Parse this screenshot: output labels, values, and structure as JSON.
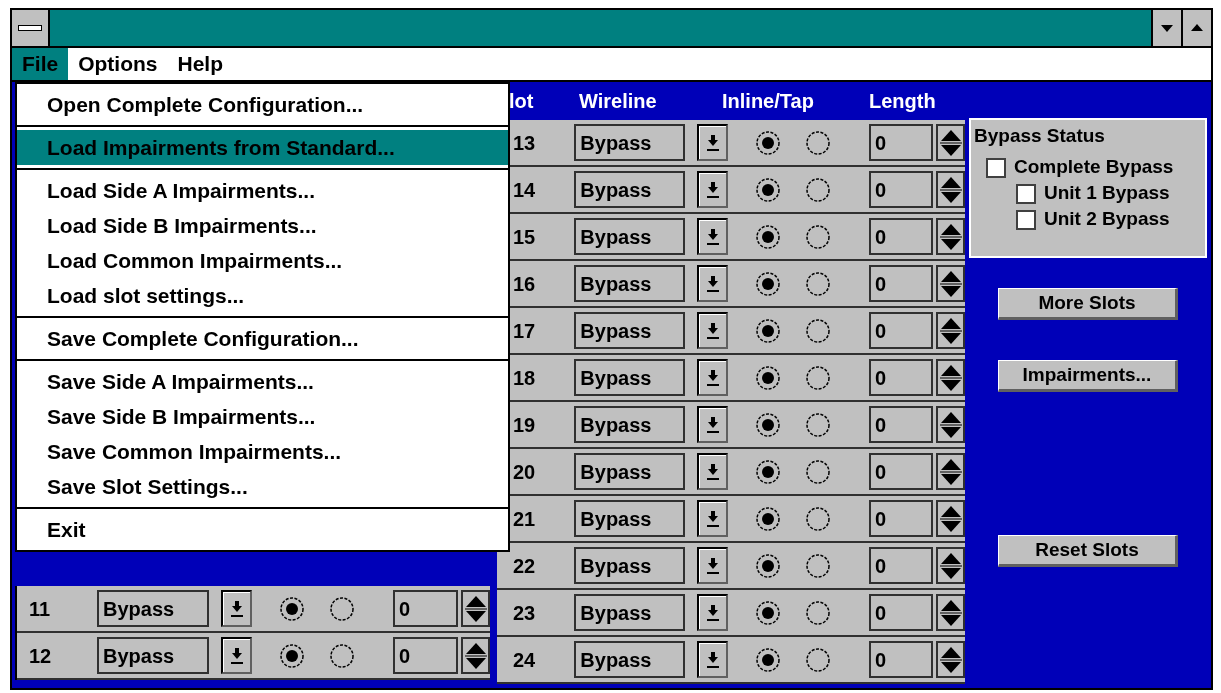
{
  "menubar": [
    {
      "label": "File",
      "selected": true
    },
    {
      "label": "Options",
      "selected": false
    },
    {
      "label": "Help",
      "selected": false
    }
  ],
  "file_menu": {
    "groups": [
      [
        {
          "label": "Open Complete Configuration...",
          "selected": false
        }
      ],
      [
        {
          "label": "Load Impairments from Standard...",
          "selected": true
        }
      ],
      [
        {
          "label": "Load Side A Impairments...",
          "selected": false
        },
        {
          "label": "Load Side B Impairments...",
          "selected": false
        },
        {
          "label": "Load Common Impairments...",
          "selected": false
        },
        {
          "label": "Load slot settings...",
          "selected": false
        }
      ],
      [
        {
          "label": "Save Complete Configuration...",
          "selected": false
        }
      ],
      [
        {
          "label": "Save Side A Impairments...",
          "selected": false
        },
        {
          "label": "Save Side B Impairments...",
          "selected": false
        },
        {
          "label": "Save Common Impairments...",
          "selected": false
        },
        {
          "label": "Save Slot Settings...",
          "selected": false
        }
      ],
      [
        {
          "label": "Exit",
          "selected": false
        }
      ]
    ]
  },
  "left_slots": [
    {
      "slot": "11",
      "wireline": "Bypass",
      "inline": true,
      "length": "0"
    },
    {
      "slot": "12",
      "wireline": "Bypass",
      "inline": true,
      "length": "0"
    }
  ],
  "right_columns": [
    "lot",
    "Wireline",
    "Inline/Tap",
    "Length"
  ],
  "right_slots": [
    {
      "slot": "13",
      "wireline": "Bypass",
      "inline": true,
      "length": "0"
    },
    {
      "slot": "14",
      "wireline": "Bypass",
      "inline": true,
      "length": "0"
    },
    {
      "slot": "15",
      "wireline": "Bypass",
      "inline": true,
      "length": "0"
    },
    {
      "slot": "16",
      "wireline": "Bypass",
      "inline": true,
      "length": "0"
    },
    {
      "slot": "17",
      "wireline": "Bypass",
      "inline": true,
      "length": "0"
    },
    {
      "slot": "18",
      "wireline": "Bypass",
      "inline": true,
      "length": "0"
    },
    {
      "slot": "19",
      "wireline": "Bypass",
      "inline": true,
      "length": "0"
    },
    {
      "slot": "20",
      "wireline": "Bypass",
      "inline": true,
      "length": "0"
    },
    {
      "slot": "21",
      "wireline": "Bypass",
      "inline": true,
      "length": "0"
    },
    {
      "slot": "22",
      "wireline": "Bypass",
      "inline": true,
      "length": "0"
    },
    {
      "slot": "23",
      "wireline": "Bypass",
      "inline": true,
      "length": "0"
    },
    {
      "slot": "24",
      "wireline": "Bypass",
      "inline": true,
      "length": "0"
    }
  ],
  "bypass_status": {
    "title": "Bypass Status",
    "options": [
      {
        "label": "Complete Bypass",
        "checked": false,
        "children": [
          {
            "label": "Unit 1 Bypass",
            "checked": false
          },
          {
            "label": "Unit 2 Bypass",
            "checked": false
          }
        ]
      }
    ]
  },
  "buttons": [
    "More Slots",
    "Impairments...",
    "Reset Slots"
  ]
}
